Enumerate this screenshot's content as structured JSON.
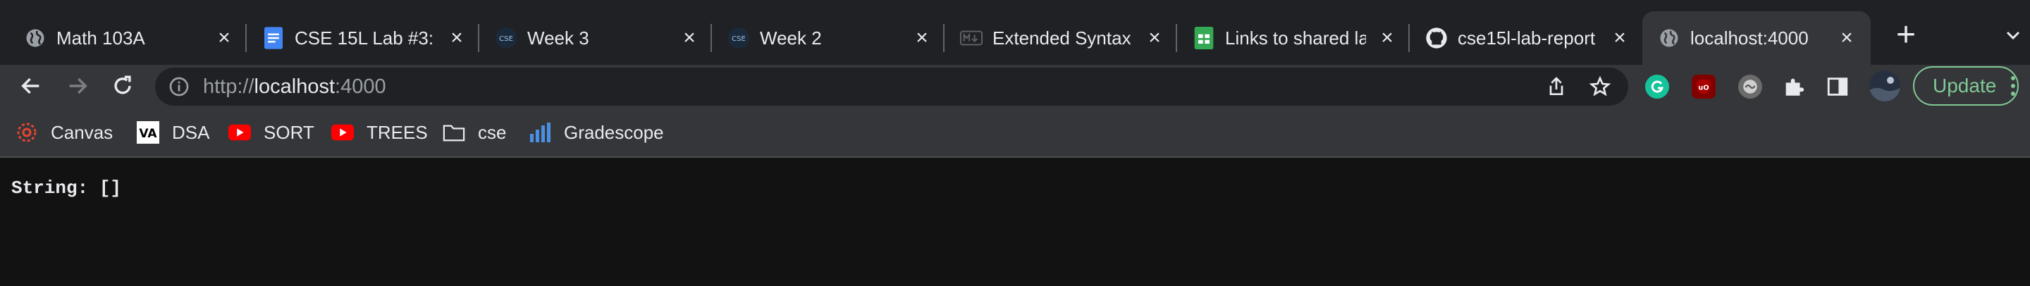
{
  "browser": {
    "tabs": [
      {
        "title": "Math 103A",
        "favicon": "globe-icon"
      },
      {
        "title": "CSE 15L Lab #3: ...",
        "favicon": "google-docs-icon"
      },
      {
        "title": "Week 3",
        "favicon": "cse-icon",
        "favicon_text": "CSE"
      },
      {
        "title": "Week 2",
        "favicon": "cse-icon",
        "favicon_text": "CSE"
      },
      {
        "title": "Extended Syntax |",
        "favicon": "markdown-icon"
      },
      {
        "title": "Links to shared la",
        "favicon": "google-sheets-icon"
      },
      {
        "title": "cse15l-lab-report",
        "favicon": "github-icon"
      },
      {
        "title": "localhost:4000",
        "favicon": "globe-icon",
        "active": true
      }
    ],
    "address": {
      "scheme": "http://",
      "host": "localhost",
      "port": ":4000"
    },
    "update_label": "Update",
    "bookmarks": [
      {
        "label": "Canvas",
        "icon": "canvas-icon"
      },
      {
        "label": "DSA",
        "icon": "dsa-icon"
      },
      {
        "label": "SORT",
        "icon": "youtube-icon"
      },
      {
        "label": "TREES",
        "icon": "youtube-icon"
      },
      {
        "label": "cse",
        "icon": "folder-icon"
      },
      {
        "label": "Gradescope",
        "icon": "gradescope-icon"
      }
    ],
    "colors": {
      "tabstrip": "#202124",
      "toolbar": "#35363a",
      "accent_green": "#81c995"
    }
  },
  "page": {
    "output_text": "String: []"
  }
}
